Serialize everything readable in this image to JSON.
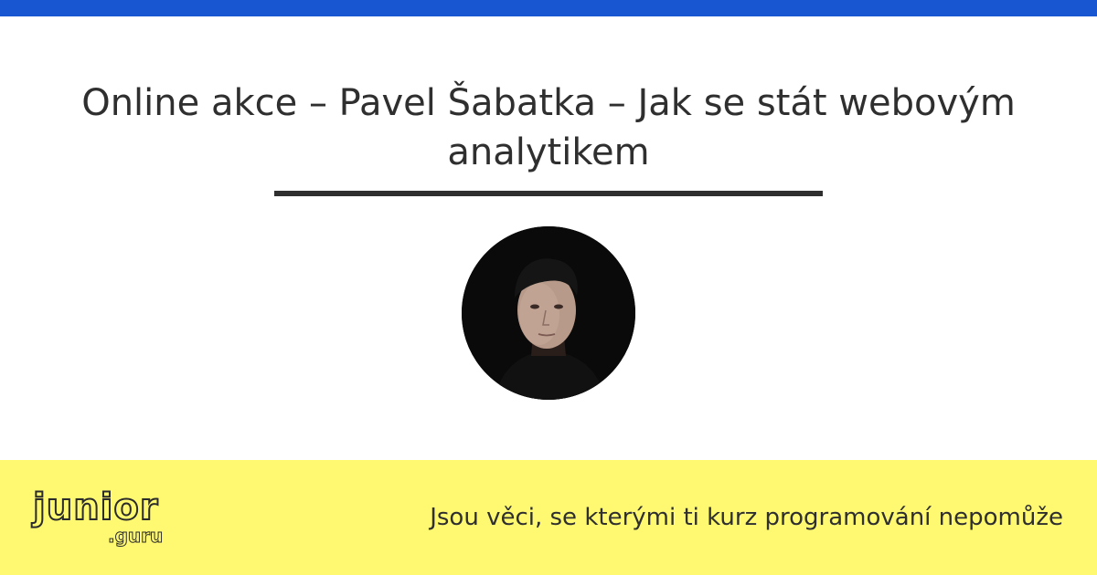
{
  "header": {
    "title": "Online akce – Pavel Šabatka – Jak se stát webovým analytikem"
  },
  "speaker": {
    "photo_icon": "speaker-portrait"
  },
  "footer": {
    "logo_main": "junior",
    "logo_sub": ".guru",
    "tagline": "Jsou věci, se kterými ti kurz programování nepomůže"
  },
  "colors": {
    "top_bar": "#1755d1",
    "footer_bg": "#fff972",
    "text": "#2f2f2f"
  }
}
